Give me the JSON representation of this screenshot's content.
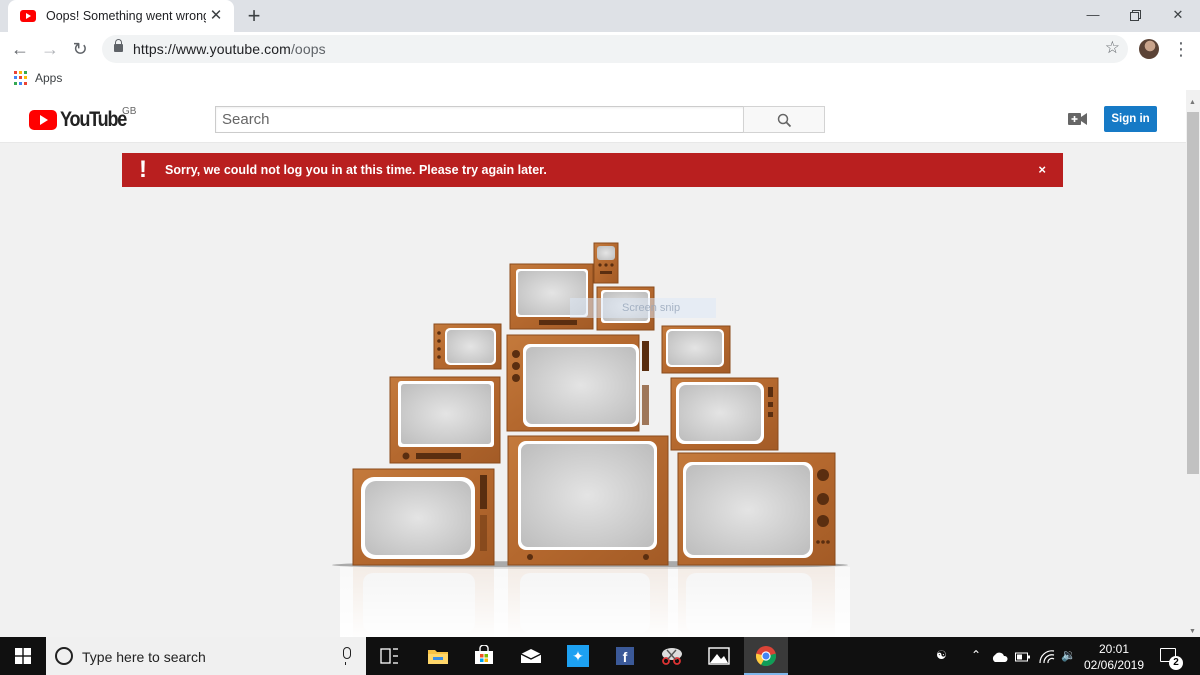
{
  "browser": {
    "tab_title": "Oops! Something went wrong. -",
    "url_host": "https://www.youtube.com",
    "url_path": "/oops",
    "bookmarks": {
      "apps_label": "Apps"
    },
    "window_controls": [
      "minimize",
      "restore",
      "close"
    ]
  },
  "youtube": {
    "logo_text": "YouTube",
    "region": "GB",
    "search_placeholder": "Search",
    "sign_in_label": "Sign in",
    "brand_red": "#ff0000",
    "sign_in_color": "#167ac6"
  },
  "alert": {
    "message": "Sorry, we could not log you in at this time. Please try again later.",
    "close_label": "×",
    "color": "#b91f1f"
  },
  "illustration": {
    "name": "stacked-vintage-tvs",
    "overlay_text": "Screen snip"
  },
  "taskbar": {
    "search_placeholder": "Type here to search",
    "apps": [
      "task-view",
      "file-explorer",
      "microsoft-store",
      "mail",
      "twitter",
      "facebook",
      "snipping-tool",
      "photos",
      "chrome"
    ],
    "time": "20:01",
    "date": "02/06/2019",
    "notification_count": "2"
  }
}
